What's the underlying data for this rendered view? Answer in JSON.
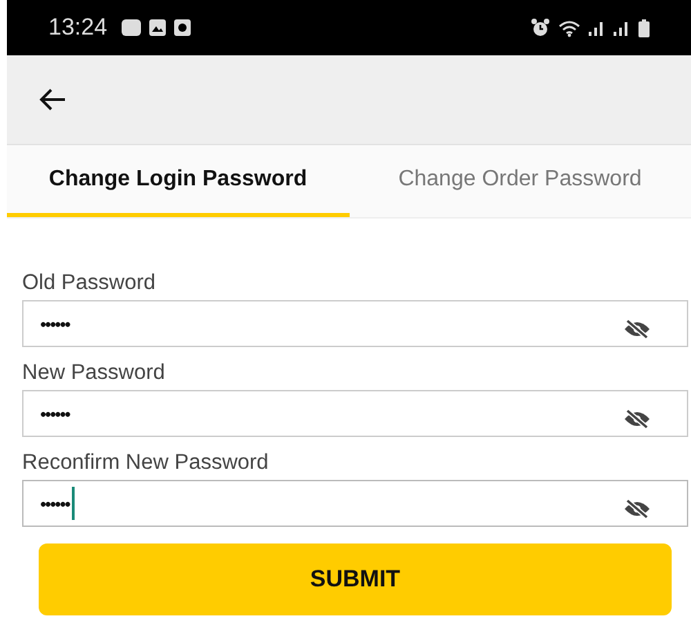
{
  "status_bar": {
    "time": "13:24"
  },
  "tabs": [
    {
      "label": "Change Login Password",
      "selected": true
    },
    {
      "label": "Change Order Password",
      "selected": false
    }
  ],
  "fields": [
    {
      "label": "Old Password",
      "value": "••••••",
      "focused": false
    },
    {
      "label": "New Password",
      "value": "••••••",
      "focused": false
    },
    {
      "label": "Reconfirm New Password",
      "value": "••••••",
      "focused": true
    }
  ],
  "submit": "SUBMIT"
}
